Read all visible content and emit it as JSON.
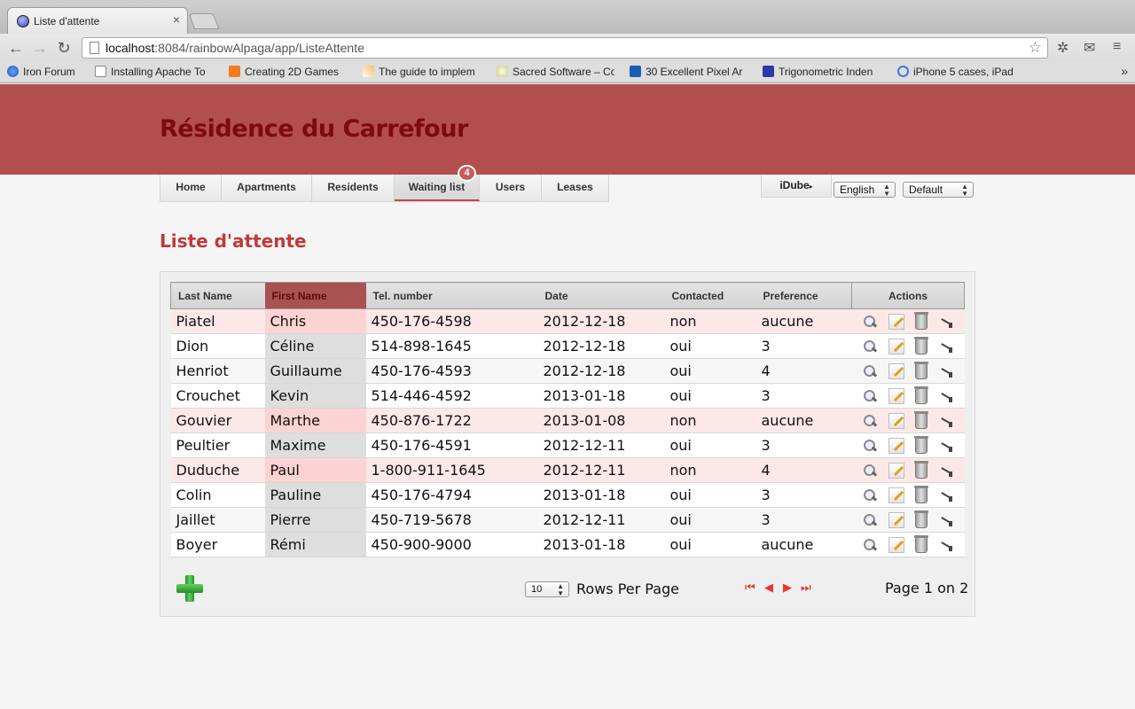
{
  "browser": {
    "tab_title": "Liste d'attente",
    "tab_close": "×",
    "url_host": "localhost",
    "url_rest": ":8084/rainbowAlpaga/app/ListeAttente",
    "back": "←",
    "forward": "→",
    "reload": "↻",
    "star": "☆",
    "bookmarks": [
      {
        "label": "Iron Forum",
        "icon": "globe-icon"
      },
      {
        "label": "Installing Apache To",
        "icon": "page-icon"
      },
      {
        "label": "Creating 2D Games",
        "icon": "blogger-icon"
      },
      {
        "label": "The guide to implem",
        "icon": "pencil-icon"
      },
      {
        "label": "Sacred Software – Co",
        "icon": "cloud-icon"
      },
      {
        "label": "30 Excellent Pixel Ar",
        "icon": "h-icon"
      },
      {
        "label": "Trigonometric Inden",
        "icon": "m-icon"
      },
      {
        "label": "iPhone 5 cases, iPad",
        "icon": "circle-icon"
      }
    ],
    "bookmarks_overflow": "»"
  },
  "site": {
    "title": "Résidence du Carrefour",
    "nav": [
      {
        "label": "Home"
      },
      {
        "label": "Apartments"
      },
      {
        "label": "Residents"
      },
      {
        "label": "Waiting list",
        "active": true
      },
      {
        "label": "Users"
      },
      {
        "label": "Leases"
      }
    ],
    "badge": "4",
    "user_menu": "iDube",
    "user_menu_arrow": "▸",
    "language": "English",
    "theme": "Default"
  },
  "page": {
    "title": "Liste d'attente"
  },
  "table": {
    "columns": [
      "Last Name",
      "First Name",
      "Tel. number",
      "Date",
      "Contacted",
      "Preference",
      "Actions"
    ],
    "sorted_column": "First Name",
    "rows": [
      {
        "last": "Piatel",
        "first": "Chris",
        "tel": "450-176-4598",
        "date": "2012-12-18",
        "contacted": "non",
        "pref": "aucune"
      },
      {
        "last": "Dion",
        "first": "Céline",
        "tel": "514-898-1645",
        "date": "2012-12-18",
        "contacted": "oui",
        "pref": "3"
      },
      {
        "last": "Henriot",
        "first": "Guillaume",
        "tel": "450-176-4593",
        "date": "2012-12-18",
        "contacted": "oui",
        "pref": "4"
      },
      {
        "last": "Crouchet",
        "first": "Kevin",
        "tel": "514-446-4592",
        "date": "2013-01-18",
        "contacted": "oui",
        "pref": "3"
      },
      {
        "last": "Gouvier",
        "first": "Marthe",
        "tel": "450-876-1722",
        "date": "2013-01-08",
        "contacted": "non",
        "pref": "aucune"
      },
      {
        "last": "Peultier",
        "first": "Maxime",
        "tel": "450-176-4591",
        "date": "2012-12-11",
        "contacted": "oui",
        "pref": "3"
      },
      {
        "last": "Duduche",
        "first": "Paul",
        "tel": "1-800-911-1645",
        "date": "2012-12-11",
        "contacted": "non",
        "pref": "4"
      },
      {
        "last": "Colin",
        "first": "Pauline",
        "tel": "450-176-4794",
        "date": "2013-01-18",
        "contacted": "oui",
        "pref": "3"
      },
      {
        "last": "Jaillet",
        "first": "Pierre",
        "tel": "450-719-5678",
        "date": "2012-12-11",
        "contacted": "oui",
        "pref": "3"
      },
      {
        "last": "Boyer",
        "first": "Rémi",
        "tel": "450-900-9000",
        "date": "2013-01-18",
        "contacted": "oui",
        "pref": "aucune"
      }
    ],
    "row_actions": [
      "view-icon",
      "edit-icon",
      "delete-icon",
      "more-icon"
    ]
  },
  "footer": {
    "rows_per_page": "10",
    "rows_per_page_label": "Rows Per Page",
    "pager": {
      "first": "⏮",
      "prev": "◀",
      "next": "▶",
      "last": "⏭"
    },
    "page_info": "Page 1 on 2"
  },
  "colors": {
    "banner": "#b24e4e",
    "title": "#7d0b0b",
    "section_title": "#c0393b",
    "uncontacted_row": "#fde8e8"
  }
}
